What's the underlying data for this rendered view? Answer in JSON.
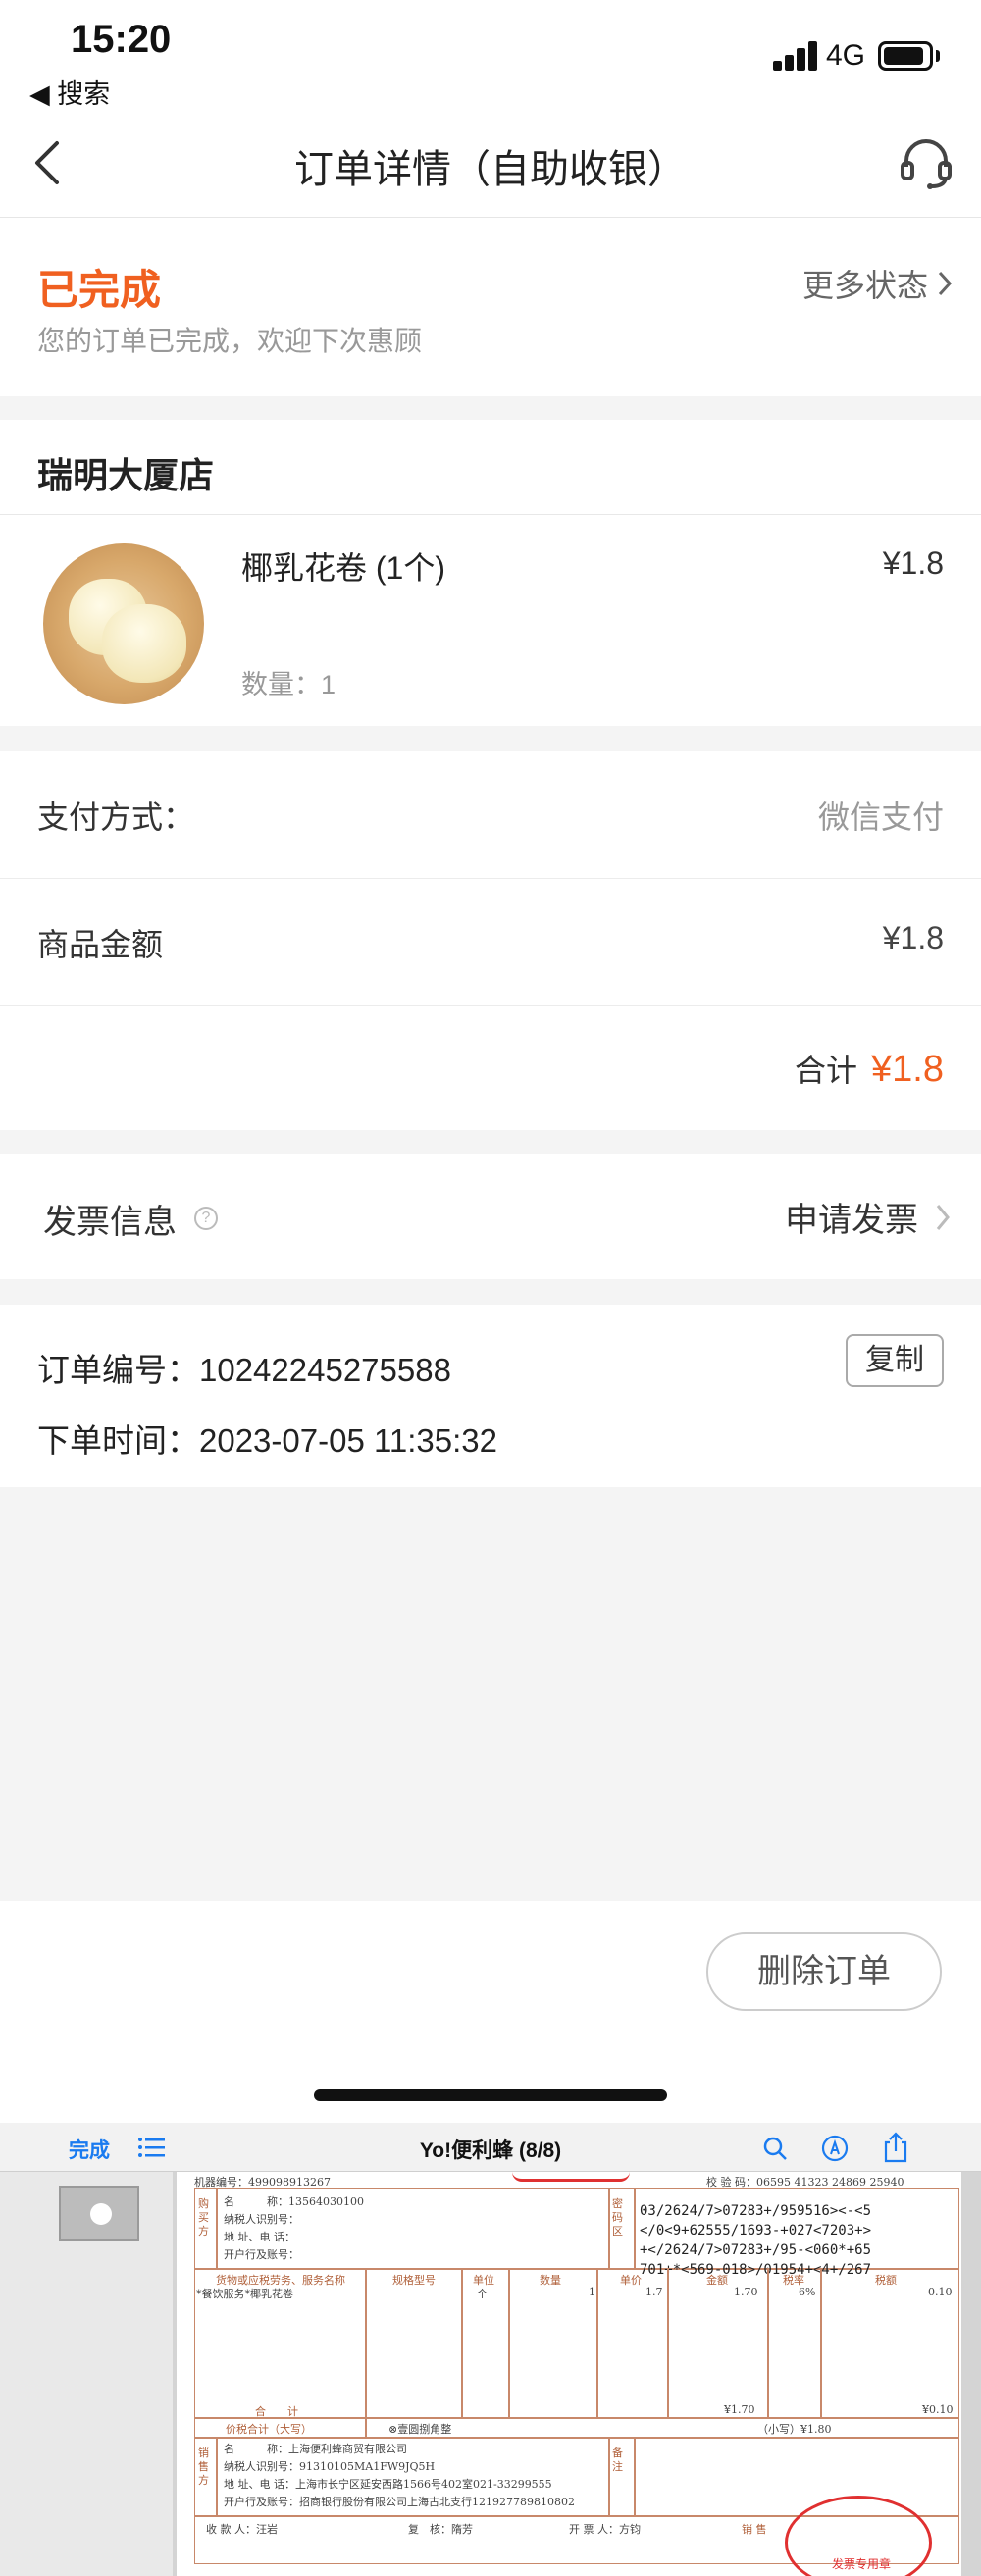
{
  "status_bar": {
    "time": "15:20",
    "back_app": "◀ 搜索",
    "network": "4G"
  },
  "header": {
    "title": "订单详情（自助收银）"
  },
  "order_status": {
    "title": "已完成",
    "subtitle": "您的订单已完成，欢迎下次惠顾",
    "more_label": "更多状态"
  },
  "store": {
    "name": "瑞明大厦店"
  },
  "product": {
    "name": "椰乳花卷 (1个)",
    "price": "¥1.8",
    "quantity": "数量：1"
  },
  "payment": {
    "method_label": "支付方式：",
    "method_value": "微信支付",
    "amount_label": "商品金额",
    "amount_value": "¥1.8",
    "total_label": "合计",
    "total_value": "¥1.8"
  },
  "invoice": {
    "label": "发票信息",
    "help": "?",
    "action": "申请发票"
  },
  "order_info": {
    "number_label": "订单编号：",
    "number_value": "10242245275588",
    "time_label": "下单时间：",
    "time_value": "2023-07-05 11:35:32",
    "copy_label": "复制"
  },
  "actions": {
    "delete_label": "删除订单"
  },
  "viewer": {
    "done_label": "完成",
    "title": "Yo!便利蜂 (8/8)",
    "invoice": {
      "machine_no": "机器编号：499098913267",
      "check_code": "校 验 码：06595 41323 24869 25940",
      "buyer_name": "名　　　称：13564030100",
      "buyer_taxid": "纳税人识别号：",
      "buyer_addr": "地 址、电 话：",
      "buyer_bank": "开户行及账号：",
      "buyer_side": "购买方",
      "cipher_side": "密码区",
      "cipher": [
        "03/2624/7>07283+/959516><-<5",
        "</0<9+62555/1693-+027<7203+>",
        "+</2624/7>07283+/95-<060*+65",
        "701+*<569-018>/01954+<4+/267"
      ],
      "col_item": "货物或应税劳务、服务名称",
      "col_spec": "规格型号",
      "col_unit": "单位",
      "col_qty": "数量",
      "col_price": "单价",
      "col_amount": "金额",
      "col_rate": "税率",
      "col_tax": "税额",
      "item_name": "*餐饮服务*椰乳花卷",
      "item_unit": "个",
      "item_qty": "1",
      "item_price": "1.7",
      "item_amount": "1.70",
      "item_rate": "6%",
      "item_tax": "0.10",
      "sum_label": "合　　计",
      "sum_amount": "¥1.70",
      "sum_tax": "¥0.10",
      "total_words_label": "价税合计（大写）",
      "total_words": "⊗壹圆捌角整",
      "total_small": "（小写）¥1.80",
      "seller_name": "名　　　称：上海便利蜂商贸有限公司",
      "seller_taxid": "纳税人识别号：91310105MA1FW9JQ5H",
      "seller_addr": "地 址、电 话：上海市长宁区延安西路1566号402室021-33299555",
      "seller_bank": "开户行及账号：招商银行股份有限公司上海古北支行121927789810802",
      "seller_side": "销售方",
      "remark_side": "备注",
      "payee": "收 款 人：汪岩",
      "reviewer": "复　核：隋芳",
      "issuer": "开 票 人：方钧",
      "seller_footer": "销 售",
      "stamp_text": "发票专用章"
    }
  }
}
